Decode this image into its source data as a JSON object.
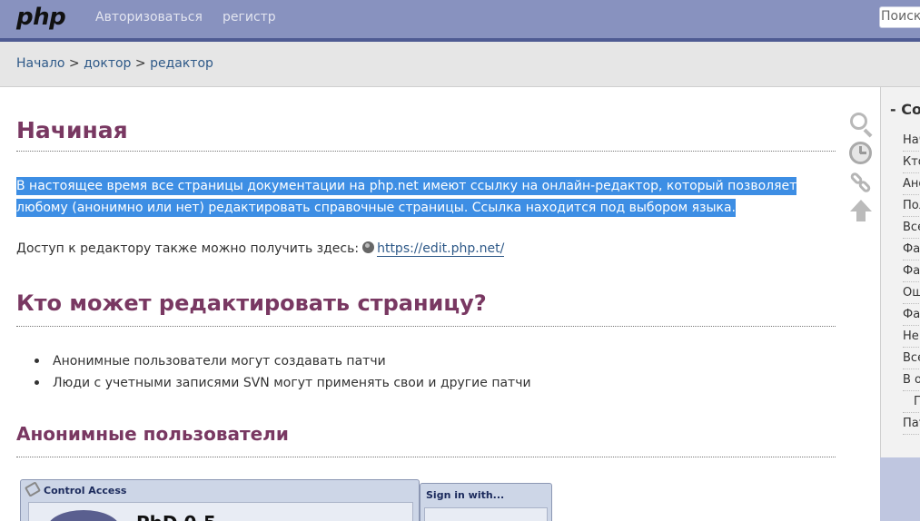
{
  "header": {
    "logo": "php",
    "nav": {
      "login": "Авторизоваться",
      "register": "регистр"
    },
    "search_placeholder": "Поиск"
  },
  "breadcrumb": {
    "home": "Начало",
    "sep1": " > ",
    "doctor": "доктор",
    "sep2": " > ",
    "editor": "редактор"
  },
  "content": {
    "heading_start": "Начиная",
    "selected_paragraph": "В настоящее время все страницы документации на php.net имеют ссылку на онлайн-редактор, который позволяет любому (анонимно или нет) редактировать справочные страницы. Ссылка находится под выбором языка.",
    "access_text": "Доступ к редактору также можно получить здесь:",
    "access_link": "https://edit.php.net/",
    "heading_who": "Кто может редактировать страницу?",
    "bullets": [
      "Анонимные пользователи могут создавать патчи",
      "Люди с учетными записями SVN могут применять свои и другие патчи"
    ],
    "heading_anon": "Анонимные пользователи",
    "screenshot": {
      "window_title": "Control Access",
      "logo_text": "PhD 0.5",
      "signin_title": "Sign in with..."
    }
  },
  "tools": {
    "search": "search-icon",
    "history": "clock-icon",
    "link": "link-icon",
    "top": "arrow-up-icon"
  },
  "sidebar": {
    "title": "- Co",
    "items": [
      {
        "label": "Нач",
        "sub": false
      },
      {
        "label": "Кто",
        "sub": false
      },
      {
        "label": "Ано",
        "sub": false
      },
      {
        "label": "Пол",
        "sub": false
      },
      {
        "label": "Все",
        "sub": false
      },
      {
        "label": "Фай",
        "sub": false
      },
      {
        "label": "Фай",
        "sub": false
      },
      {
        "label": "Оши",
        "sub": false
      },
      {
        "label": "Фай",
        "sub": false
      },
      {
        "label": "Не",
        "sub": false
      },
      {
        "label": "Все",
        "sub": false
      },
      {
        "label": "В о",
        "sub": false
      },
      {
        "label": "П",
        "sub": true
      },
      {
        "label": "Пат",
        "sub": false
      }
    ]
  },
  "colors": {
    "header_bg": "#8892bf",
    "header_border": "#4f5b93",
    "heading": "#793862",
    "link": "#2e5988",
    "selection": "#3d8ee4"
  }
}
